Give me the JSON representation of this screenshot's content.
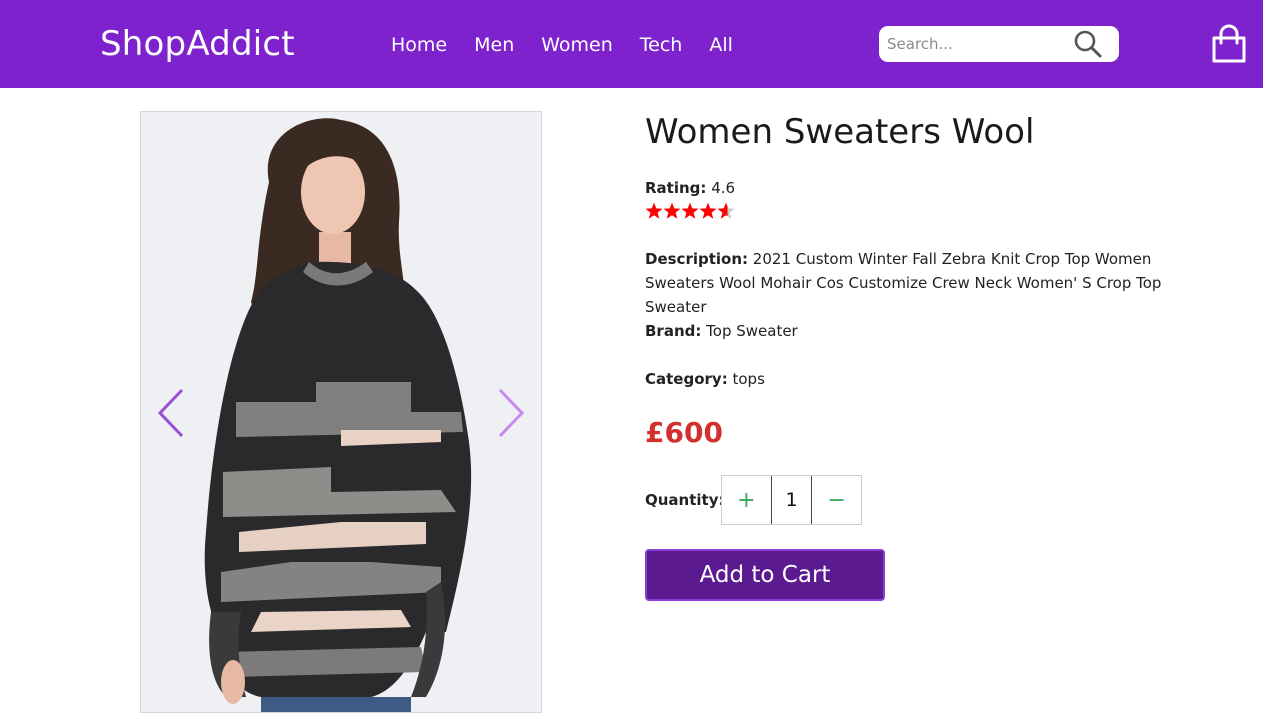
{
  "header": {
    "logo": "ShopAddict",
    "nav": [
      "Home",
      "Men",
      "Women",
      "Tech",
      "All"
    ],
    "search_placeholder": "Search...",
    "search_value": "",
    "search_icon": "search-icon",
    "cart_icon": "shopping-bag-icon",
    "bg_color": "#7e22ce"
  },
  "product": {
    "title": "Women Sweaters Wool",
    "rating_label": "Rating:",
    "rating_value": "4.6",
    "rating_stars": 4.6,
    "rating_max": 5,
    "description_label": "Description:",
    "description": "2021 Custom Winter Fall Zebra Knit Crop Top Women Sweaters Wool Mohair Cos Customize Crew Neck Women' S Crop Top Sweater",
    "brand_label": "Brand:",
    "brand": "Top Sweater",
    "category_label": "Category:",
    "category": "tops",
    "price": "£600",
    "price_color": "#d32f2f",
    "quantity_label": "Quantity:",
    "quantity": "1",
    "qty_plus": "+",
    "qty_minus": "−",
    "add_to_cart": "Add to Cart",
    "star_color": "#ff0000"
  },
  "gallery": {
    "prev_icon": "chevron-left-icon",
    "next_icon": "chevron-right-icon",
    "arrow_color": "#9b4dd9"
  }
}
